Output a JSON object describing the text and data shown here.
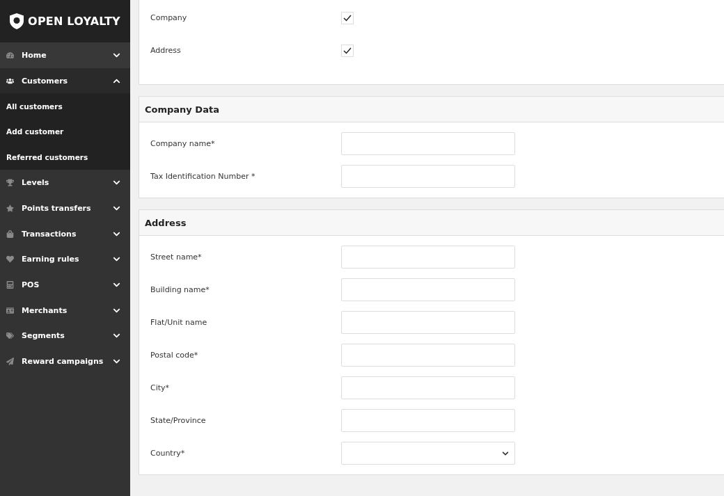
{
  "sidebar": {
    "logo": "OPEN LOYALTY",
    "items": [
      {
        "label": "Home",
        "expanded": false
      },
      {
        "label": "Customers",
        "expanded": true,
        "children": [
          {
            "label": "All customers"
          },
          {
            "label": "Add customer"
          },
          {
            "label": "Referred customers"
          }
        ]
      },
      {
        "label": "Levels",
        "expanded": false
      },
      {
        "label": "Points transfers",
        "expanded": false
      },
      {
        "label": "Transactions",
        "expanded": false
      },
      {
        "label": "Earning rules",
        "expanded": false
      },
      {
        "label": "POS",
        "expanded": false
      },
      {
        "label": "Merchants",
        "expanded": false
      },
      {
        "label": "Segments",
        "expanded": false
      },
      {
        "label": "Reward campaigns",
        "expanded": false
      }
    ]
  },
  "options": [
    {
      "label": "Company",
      "checked": true
    },
    {
      "label": "Address",
      "checked": true
    }
  ],
  "sections": [
    {
      "title": "Company Data",
      "fields": [
        {
          "label": "Company name*",
          "kind": "text"
        },
        {
          "label": "Tax Identification Number *",
          "kind": "text"
        }
      ]
    },
    {
      "title": "Address",
      "fields": [
        {
          "label": "Street name*",
          "kind": "text"
        },
        {
          "label": "Building name*",
          "kind": "text"
        },
        {
          "label": "Flat/Unit name",
          "kind": "text"
        },
        {
          "label": "Postal code*",
          "kind": "text"
        },
        {
          "label": "City*",
          "kind": "text"
        },
        {
          "label": "State/Province",
          "kind": "text"
        },
        {
          "label": "Country*",
          "kind": "select"
        }
      ]
    }
  ]
}
